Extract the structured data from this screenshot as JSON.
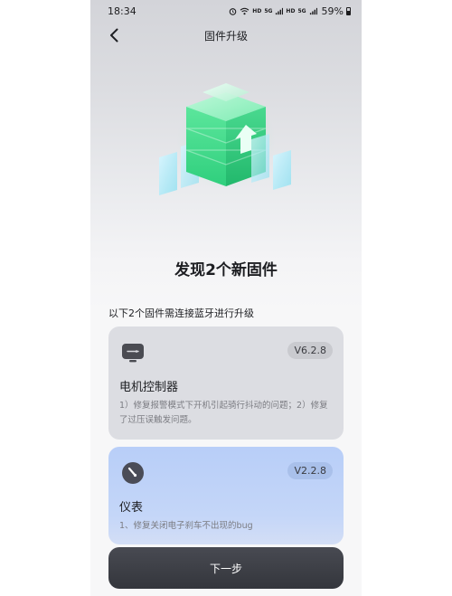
{
  "status_bar": {
    "time": "18:34",
    "network_labels": [
      "HD",
      "5G",
      "HD",
      "5G"
    ],
    "battery": "59%"
  },
  "nav": {
    "title": "固件升级",
    "back_icon": "chevron-left-icon"
  },
  "hero": {
    "icon": "firmware-upgrade-cube-icon",
    "accent": "#3fe08c"
  },
  "headline": "发现2个新固件",
  "subtitle": "以下2个固件需连接蓝牙进行升级",
  "firmware": [
    {
      "icon": "monitor-icon",
      "version": "V6.2.8",
      "name": "电机控制器",
      "description": "1）修复报警模式下开机引起骑行抖动的问题；2）修复了过压误触发问题。"
    },
    {
      "icon": "gauge-icon",
      "version": "V2.2.8",
      "name": "仪表",
      "description": "1、修复关闭电子刹车不出现的bug"
    }
  ],
  "next_button": "下一步",
  "colors": {
    "card_gray": "#dcdde2",
    "card_blue": "#c4d6f8",
    "button_dark": "#3a3c42"
  }
}
